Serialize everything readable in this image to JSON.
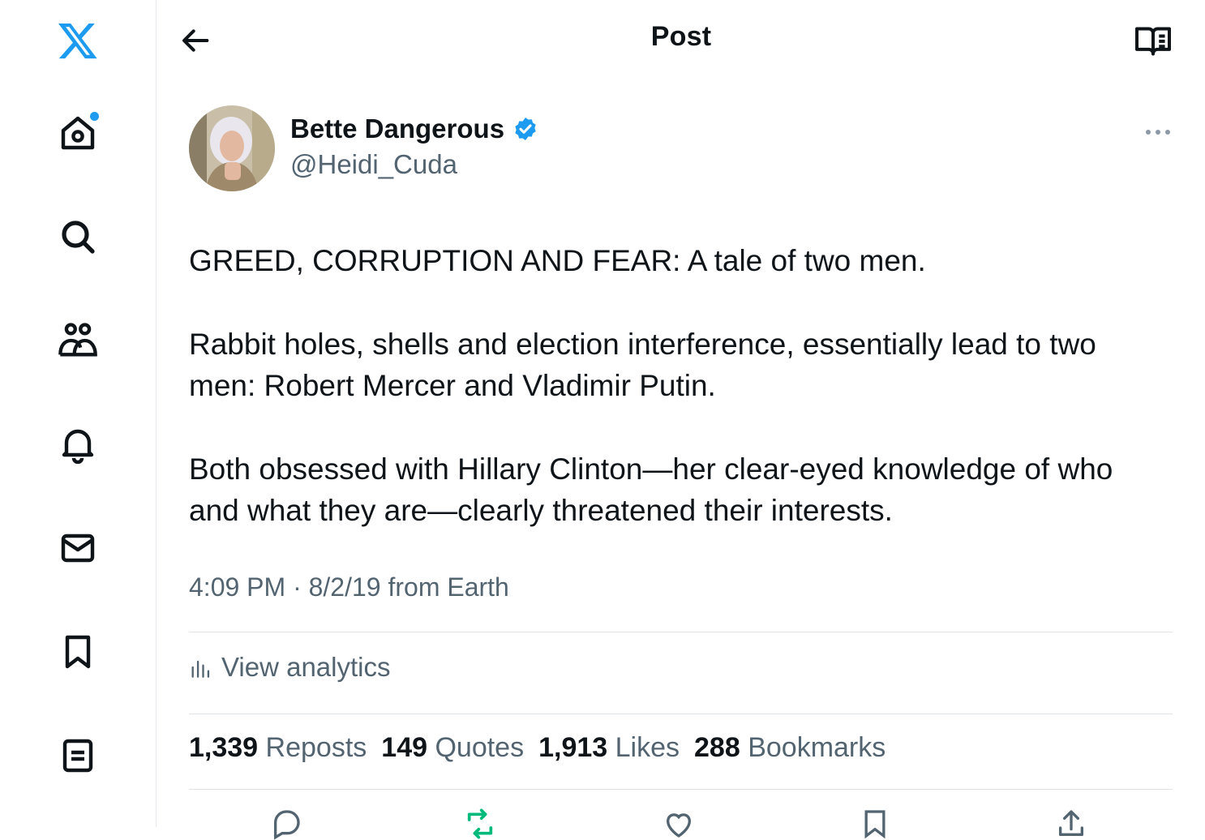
{
  "header": {
    "title": "Post"
  },
  "post": {
    "author_name": "Bette Dangerous",
    "author_handle": "@Heidi_Cuda",
    "paragraphs": [
      "GREED, CORRUPTION AND FEAR: A tale of two men.",
      "Rabbit holes, shells and election interference, essentially lead to two men: Robert Mercer and Vladimir Putin.",
      "Both obsessed with Hillary Clinton—her clear-eyed knowledge of who and what they are—clearly threatened their interests."
    ],
    "meta": "4:09 PM · 8/2/19 from Earth",
    "analytics_label": "View analytics",
    "stats": {
      "reposts_count": "1,339",
      "reposts_label": "Reposts",
      "quotes_count": "149",
      "quotes_label": "Quotes",
      "likes_count": "1,913",
      "likes_label": "Likes",
      "bookmarks_count": "288",
      "bookmarks_label": "Bookmarks"
    }
  },
  "sidebar": {
    "items": [
      "x-logo",
      "home-icon",
      "search-icon",
      "communities-icon",
      "notifications-icon",
      "messages-icon",
      "bookmarks-icon",
      "lists-icon"
    ]
  },
  "colors": {
    "accent": "#1d9bf0",
    "repost_active": "#00ba7c",
    "muted": "#536471",
    "text": "#0f1419"
  }
}
